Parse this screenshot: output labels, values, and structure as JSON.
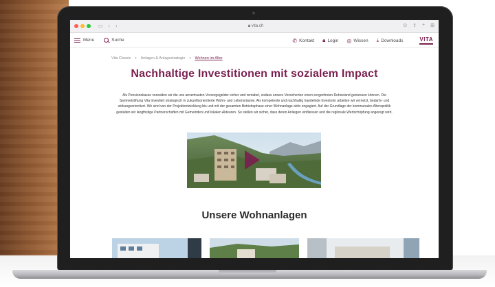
{
  "browser": {
    "address": "vita.ch"
  },
  "header": {
    "menu_label": "Menu",
    "search_label": "Suche",
    "contact_label": "Kontakt",
    "login_label": "Login",
    "knowledge_label": "Wissen",
    "downloads_label": "Downloads",
    "logo_text": "VITA"
  },
  "breadcrumb": {
    "items": [
      "Vita Classic",
      "Anlagen & Anlagestrategie",
      "Wohnen im Alter"
    ]
  },
  "main": {
    "title": "Nachhaltige Investitionen mit sozialem Impact",
    "intro": "Als Pensionskasse verwalten wir die uns anvertrauten Vorsorgegelder sicher und rentabel, sodass unsere Versicherten einen sorgenfreien Ruhestand geniessen können. Die Sammelstiftung Vita investiert strategisch in zukunftsorientierte Wohn- und Lebensräume. Als kompetente und nachhaltig handelnde Investorin arbeiten wir vernetzt, bedarfs- und wirkungsorientiert. Wir sind von der Projektentwicklung bis und mit der gesamten Betriebsphase einer Wohnanlage aktiv engagiert. Auf der Grundlage der kommunalen Alterspolitik gestalten wir langfristige Partnerschaften mit Gemeinden und lokalen Akteuren. So stellen wir sicher, dass deren Anliegen einfliessen und die regionale Wertschöpfung angeregt wird.",
    "section_title": "Unsere Wohnanlagen"
  },
  "colors": {
    "brand": "#7a1f4f"
  },
  "icons": {
    "menu": "hamburger-icon",
    "search": "search-icon",
    "contact": "phone-icon",
    "login": "lock-icon",
    "knowledge": "bulb-icon",
    "downloads": "download-icon"
  }
}
